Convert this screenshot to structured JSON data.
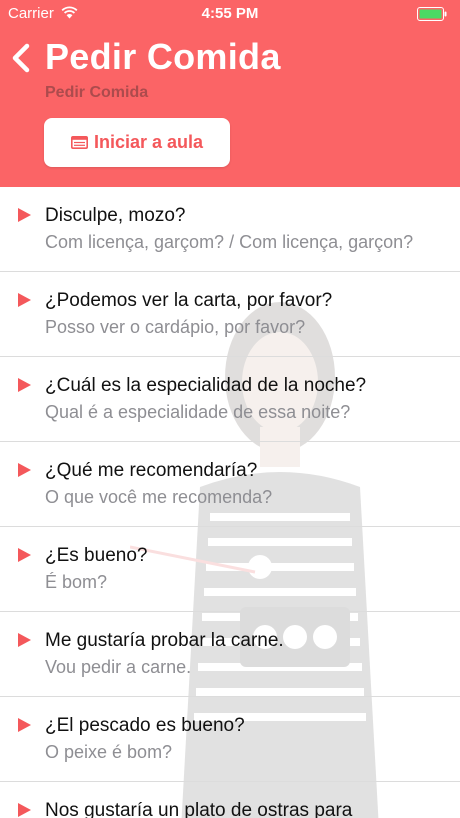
{
  "status_bar": {
    "carrier": "Carrier",
    "time": "4:55 PM",
    "wifi_icon": "wifi-icon",
    "battery_icon": "battery-icon"
  },
  "header": {
    "back_icon": "chevron-left-icon",
    "title": "Pedir Comida",
    "subtitle": "Pedir Comida",
    "start_button": {
      "label": "Iniciar a aula",
      "icon": "lesson-card-icon"
    },
    "background_color": "#fb6466",
    "accent_color": "#f4585b"
  },
  "phrases": [
    {
      "spanish": "Disculpe, mozo?",
      "portuguese": "Com licença, garçom? / Com licença, garçon?"
    },
    {
      "spanish": "¿Podemos ver la carta, por favor?",
      "portuguese": "Posso ver o cardápio, por favor?"
    },
    {
      "spanish": "¿Cuál es la especialidad de la noche?",
      "portuguese": "Qual é a especialidade de essa noite?"
    },
    {
      "spanish": "¿Qué me recomendaría?",
      "portuguese": "O que você me recomenda?"
    },
    {
      "spanish": "¿Es bueno?",
      "portuguese": "É bom?"
    },
    {
      "spanish": "Me gustaría probar la carne.",
      "portuguese": "Vou pedir a carne."
    },
    {
      "spanish": "¿El pescado es bueno?",
      "portuguese": "O peixe é bom?"
    },
    {
      "spanish": "Nos gustaría un plato de ostras para",
      "portuguese": ""
    }
  ],
  "play_icon": "play-icon",
  "play_color": "#f4585b"
}
